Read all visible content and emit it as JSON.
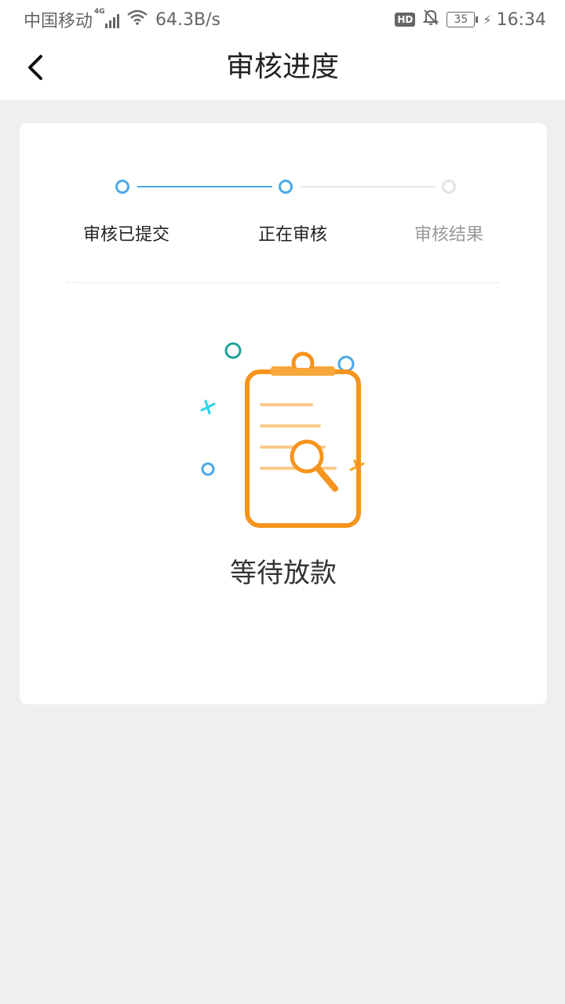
{
  "status_bar": {
    "carrier": "中国移动",
    "network_tag": "4G",
    "speed": "64.3B/s",
    "hd": "HD",
    "battery": "35",
    "time": "16:34"
  },
  "nav": {
    "title": "审核进度",
    "back_icon": "chevron-left-icon"
  },
  "progress": {
    "steps": [
      {
        "label": "审核已提交",
        "state": "done"
      },
      {
        "label": "正在审核",
        "state": "current"
      },
      {
        "label": "审核结果",
        "state": "pending"
      }
    ],
    "active_color": "#4aa8e8",
    "inactive_color": "#e3e3e3"
  },
  "result": {
    "illustration": "clipboard-search-icon",
    "status_text": "等待放款"
  }
}
